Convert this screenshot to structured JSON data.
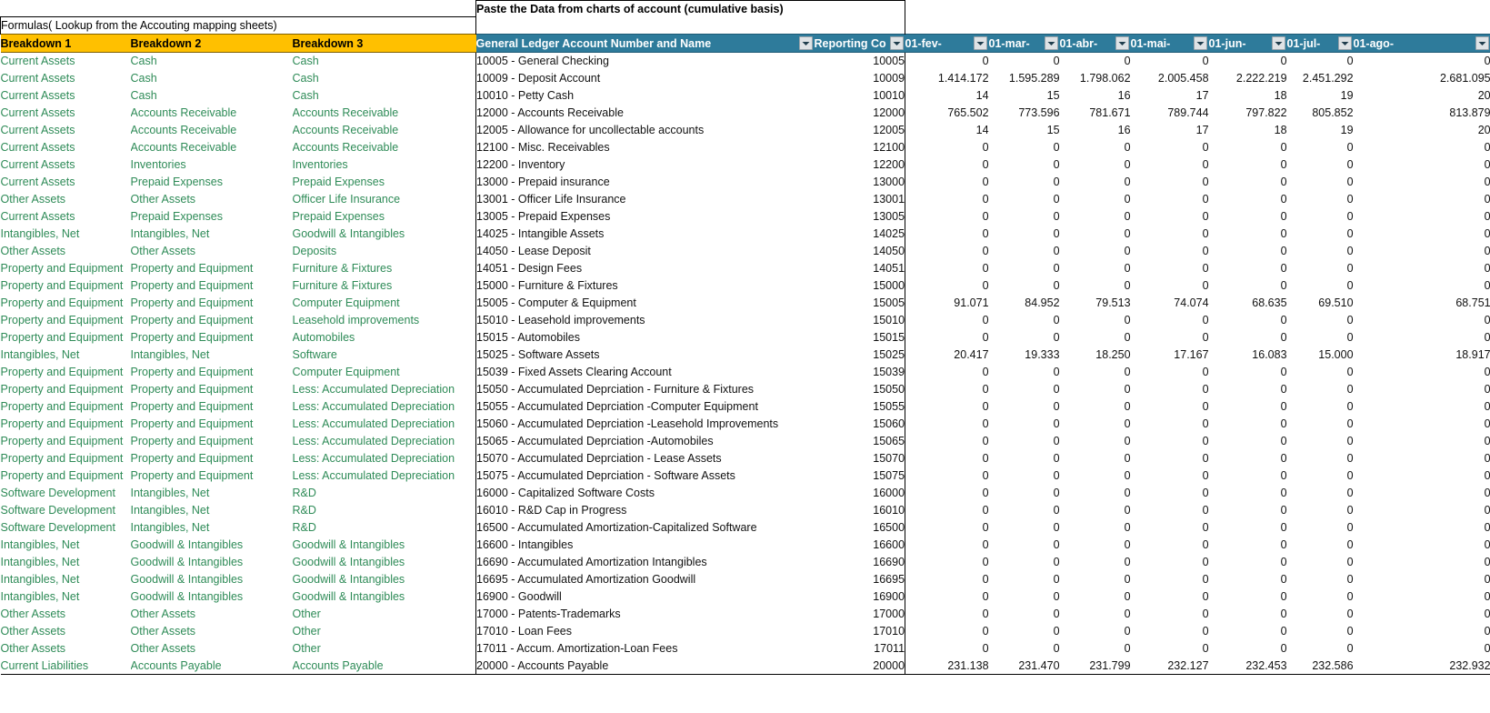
{
  "banner": {
    "title": "Paste  the Data from charts of account (cumulative basis)"
  },
  "note": {
    "text": "Formulas( Lookup from the Accouting mapping sheets)"
  },
  "headers": {
    "breakdown1": "Breakdown 1",
    "breakdown2": "Breakdown 2",
    "breakdown3": "Breakdown 3",
    "gl": "General Ledger Account Number and Name",
    "reporting": "Reporting Co",
    "periods": [
      "01-fev-",
      "01-mar-",
      "01-abr-",
      "01-mai-",
      "01-jun-",
      "01-jul-",
      "01-ago-"
    ]
  },
  "colors": {
    "header_yellow": "#FFC000",
    "header_teal": "#2E7B9B",
    "breakdown_text": "#2E8B57",
    "grid_text": "#111111"
  },
  "icons": {
    "filter": "filter-dropdown-icon"
  },
  "rows": [
    {
      "b1": "Current Assets",
      "b2": "Cash",
      "b3": "Cash",
      "gl": "10005 - General Checking",
      "code": "10005",
      "v": [
        "0",
        "0",
        "0",
        "0",
        "0",
        "0",
        "0"
      ]
    },
    {
      "b1": "Current Assets",
      "b2": "Cash",
      "b3": "Cash",
      "gl": "10009 - Deposit Account",
      "code": "10009",
      "v": [
        "1.414.172",
        "1.595.289",
        "1.798.062",
        "2.005.458",
        "2.222.219",
        "2.451.292",
        "2.681.095"
      ]
    },
    {
      "b1": "Current Assets",
      "b2": "Cash",
      "b3": "Cash",
      "gl": "10010 - Petty Cash",
      "code": "10010",
      "v": [
        "14",
        "15",
        "16",
        "17",
        "18",
        "19",
        "20"
      ]
    },
    {
      "b1": "Current Assets",
      "b2": "Accounts Receivable",
      "b3": "Accounts Receivable",
      "gl": "12000 - Accounts Receivable",
      "code": "12000",
      "v": [
        "765.502",
        "773.596",
        "781.671",
        "789.744",
        "797.822",
        "805.852",
        "813.879"
      ]
    },
    {
      "b1": "Current Assets",
      "b2": "Accounts Receivable",
      "b3": "Accounts Receivable",
      "gl": "12005 - Allowance for uncollectable accounts",
      "code": "12005",
      "v": [
        "14",
        "15",
        "16",
        "17",
        "18",
        "19",
        "20"
      ]
    },
    {
      "b1": "Current Assets",
      "b2": "Accounts Receivable",
      "b3": "Accounts Receivable",
      "gl": "12100 - Misc. Receivables",
      "code": "12100",
      "v": [
        "0",
        "0",
        "0",
        "0",
        "0",
        "0",
        "0"
      ]
    },
    {
      "b1": "Current Assets",
      "b2": "Inventories",
      "b3": "Inventories",
      "gl": "12200 - Inventory",
      "code": "12200",
      "v": [
        "0",
        "0",
        "0",
        "0",
        "0",
        "0",
        "0"
      ]
    },
    {
      "b1": "Current Assets",
      "b2": "Prepaid Expenses",
      "b3": "Prepaid Expenses",
      "gl": "13000 - Prepaid insurance",
      "code": "13000",
      "v": [
        "0",
        "0",
        "0",
        "0",
        "0",
        "0",
        "0"
      ]
    },
    {
      "b1": "Other Assets",
      "b2": "Other Assets",
      "b3": "Officer Life Insurance",
      "gl": "13001 - Officer Life Insurance",
      "code": "13001",
      "v": [
        "0",
        "0",
        "0",
        "0",
        "0",
        "0",
        "0"
      ]
    },
    {
      "b1": "Current Assets",
      "b2": "Prepaid Expenses",
      "b3": "Prepaid Expenses",
      "gl": "13005 - Prepaid Expenses",
      "code": "13005",
      "v": [
        "0",
        "0",
        "0",
        "0",
        "0",
        "0",
        "0"
      ]
    },
    {
      "b1": "Intangibles, Net",
      "b2": "Intangibles, Net",
      "b3": "Goodwill & Intangibles",
      "gl": "14025 - Intangible Assets",
      "code": "14025",
      "v": [
        "0",
        "0",
        "0",
        "0",
        "0",
        "0",
        "0"
      ]
    },
    {
      "b1": "Other Assets",
      "b2": "Other Assets",
      "b3": "Deposits",
      "gl": "14050 - Lease Deposit",
      "code": "14050",
      "v": [
        "0",
        "0",
        "0",
        "0",
        "0",
        "0",
        "0"
      ]
    },
    {
      "b1": "Property and Equipment",
      "b2": "Property and Equipment",
      "b3": "Furniture & Fixtures",
      "gl": "14051 - Design Fees",
      "code": "14051",
      "v": [
        "0",
        "0",
        "0",
        "0",
        "0",
        "0",
        "0"
      ]
    },
    {
      "b1": "Property and Equipment",
      "b2": "Property and Equipment",
      "b3": "Furniture & Fixtures",
      "gl": "15000 - Furniture & Fixtures",
      "code": "15000",
      "v": [
        "0",
        "0",
        "0",
        "0",
        "0",
        "0",
        "0"
      ]
    },
    {
      "b1": "Property and Equipment",
      "b2": "Property and Equipment",
      "b3": "Computer Equipment",
      "gl": "15005 - Computer & Equipment",
      "code": "15005",
      "v": [
        "91.071",
        "84.952",
        "79.513",
        "74.074",
        "68.635",
        "69.510",
        "68.751"
      ]
    },
    {
      "b1": "Property and Equipment",
      "b2": "Property and Equipment",
      "b3": "Leasehold improvements",
      "gl": "15010 - Leasehold improvements",
      "code": "15010",
      "v": [
        "0",
        "0",
        "0",
        "0",
        "0",
        "0",
        "0"
      ]
    },
    {
      "b1": "Property and Equipment",
      "b2": "Property and Equipment",
      "b3": "Automobiles",
      "gl": "15015 - Automobiles",
      "code": "15015",
      "v": [
        "0",
        "0",
        "0",
        "0",
        "0",
        "0",
        "0"
      ]
    },
    {
      "b1": "Intangibles, Net",
      "b2": "Intangibles, Net",
      "b3": "Software",
      "gl": "15025 - Software Assets",
      "code": "15025",
      "v": [
        "20.417",
        "19.333",
        "18.250",
        "17.167",
        "16.083",
        "15.000",
        "18.917"
      ]
    },
    {
      "b1": "Property and Equipment",
      "b2": "Property and Equipment",
      "b3": "Computer Equipment",
      "gl": "15039 - Fixed Assets Clearing Account",
      "code": "15039",
      "v": [
        "0",
        "0",
        "0",
        "0",
        "0",
        "0",
        "0"
      ]
    },
    {
      "b1": "Property and Equipment",
      "b2": "Property and Equipment",
      "b3": "Less: Accumulated Depreciation",
      "gl": "15050 - Accumulated Deprciation - Furniture & Fixtures",
      "code": "15050",
      "v": [
        "0",
        "0",
        "0",
        "0",
        "0",
        "0",
        "0"
      ]
    },
    {
      "b1": "Property and Equipment",
      "b2": "Property and Equipment",
      "b3": "Less: Accumulated Depreciation",
      "gl": "15055 - Accumulated Deprciation -Computer Equipment",
      "code": "15055",
      "v": [
        "0",
        "0",
        "0",
        "0",
        "0",
        "0",
        "0"
      ]
    },
    {
      "b1": "Property and Equipment",
      "b2": "Property and Equipment",
      "b3": "Less: Accumulated Depreciation",
      "gl": "15060 - Accumulated Deprciation -Leasehold Improvements",
      "code": "15060",
      "v": [
        "0",
        "0",
        "0",
        "0",
        "0",
        "0",
        "0"
      ]
    },
    {
      "b1": "Property and Equipment",
      "b2": "Property and Equipment",
      "b3": "Less: Accumulated Depreciation",
      "gl": "15065 - Accumulated Deprciation -Automobiles",
      "code": "15065",
      "v": [
        "0",
        "0",
        "0",
        "0",
        "0",
        "0",
        "0"
      ]
    },
    {
      "b1": "Property and Equipment",
      "b2": "Property and Equipment",
      "b3": "Less: Accumulated Depreciation",
      "gl": "15070 - Accumulated Deprciation - Lease Assets",
      "code": "15070",
      "v": [
        "0",
        "0",
        "0",
        "0",
        "0",
        "0",
        "0"
      ]
    },
    {
      "b1": "Property and Equipment",
      "b2": "Property and Equipment",
      "b3": "Less: Accumulated Depreciation",
      "gl": "15075 - Accumulated Deprciation - Software Assets",
      "code": "15075",
      "v": [
        "0",
        "0",
        "0",
        "0",
        "0",
        "0",
        "0"
      ]
    },
    {
      "b1": "Software Development",
      "b2": "Intangibles, Net",
      "b3": "R&D",
      "gl": "16000 - Capitalized Software Costs",
      "code": "16000",
      "v": [
        "0",
        "0",
        "0",
        "0",
        "0",
        "0",
        "0"
      ]
    },
    {
      "b1": "Software Development",
      "b2": "Intangibles, Net",
      "b3": "R&D",
      "gl": "16010 - R&D Cap in Progress",
      "code": "16010",
      "v": [
        "0",
        "0",
        "0",
        "0",
        "0",
        "0",
        "0"
      ]
    },
    {
      "b1": "Software Development",
      "b2": "Intangibles, Net",
      "b3": "R&D",
      "gl": "16500 - Accumulated Amortization-Capitalized Software",
      "code": "16500",
      "v": [
        "0",
        "0",
        "0",
        "0",
        "0",
        "0",
        "0"
      ]
    },
    {
      "b1": "Intangibles, Net",
      "b2": "Goodwill & Intangibles",
      "b3": "Goodwill & Intangibles",
      "gl": "16600 - Intangibles",
      "code": "16600",
      "v": [
        "0",
        "0",
        "0",
        "0",
        "0",
        "0",
        "0"
      ]
    },
    {
      "b1": "Intangibles, Net",
      "b2": "Goodwill & Intangibles",
      "b3": "Goodwill & Intangibles",
      "gl": "16690 - Accumulated Amortization Intangibles",
      "code": "16690",
      "v": [
        "0",
        "0",
        "0",
        "0",
        "0",
        "0",
        "0"
      ]
    },
    {
      "b1": "Intangibles, Net",
      "b2": "Goodwill & Intangibles",
      "b3": "Goodwill & Intangibles",
      "gl": "16695 - Accumulated Amortization Goodwill",
      "code": "16695",
      "v": [
        "0",
        "0",
        "0",
        "0",
        "0",
        "0",
        "0"
      ]
    },
    {
      "b1": "Intangibles, Net",
      "b2": "Goodwill & Intangibles",
      "b3": "Goodwill & Intangibles",
      "gl": "16900 - Goodwill",
      "code": "16900",
      "v": [
        "0",
        "0",
        "0",
        "0",
        "0",
        "0",
        "0"
      ]
    },
    {
      "b1": "Other Assets",
      "b2": "Other Assets",
      "b3": "Other",
      "gl": "17000 - Patents-Trademarks",
      "code": "17000",
      "v": [
        "0",
        "0",
        "0",
        "0",
        "0",
        "0",
        "0"
      ]
    },
    {
      "b1": "Other Assets",
      "b2": "Other Assets",
      "b3": "Other",
      "gl": "17010 - Loan Fees",
      "code": "17010",
      "v": [
        "0",
        "0",
        "0",
        "0",
        "0",
        "0",
        "0"
      ]
    },
    {
      "b1": "Other Assets",
      "b2": "Other Assets",
      "b3": "Other",
      "gl": "17011 - Accum. Amortization-Loan Fees",
      "code": "17011",
      "v": [
        "0",
        "0",
        "0",
        "0",
        "0",
        "0",
        "0"
      ]
    },
    {
      "b1": "Current Liabilities",
      "b2": "Accounts Payable",
      "b3": "Accounts Payable",
      "gl": "20000 - Accounts Payable",
      "code": "20000",
      "v": [
        "231.138",
        "231.470",
        "231.799",
        "232.127",
        "232.453",
        "232.586",
        "232.932"
      ]
    }
  ]
}
